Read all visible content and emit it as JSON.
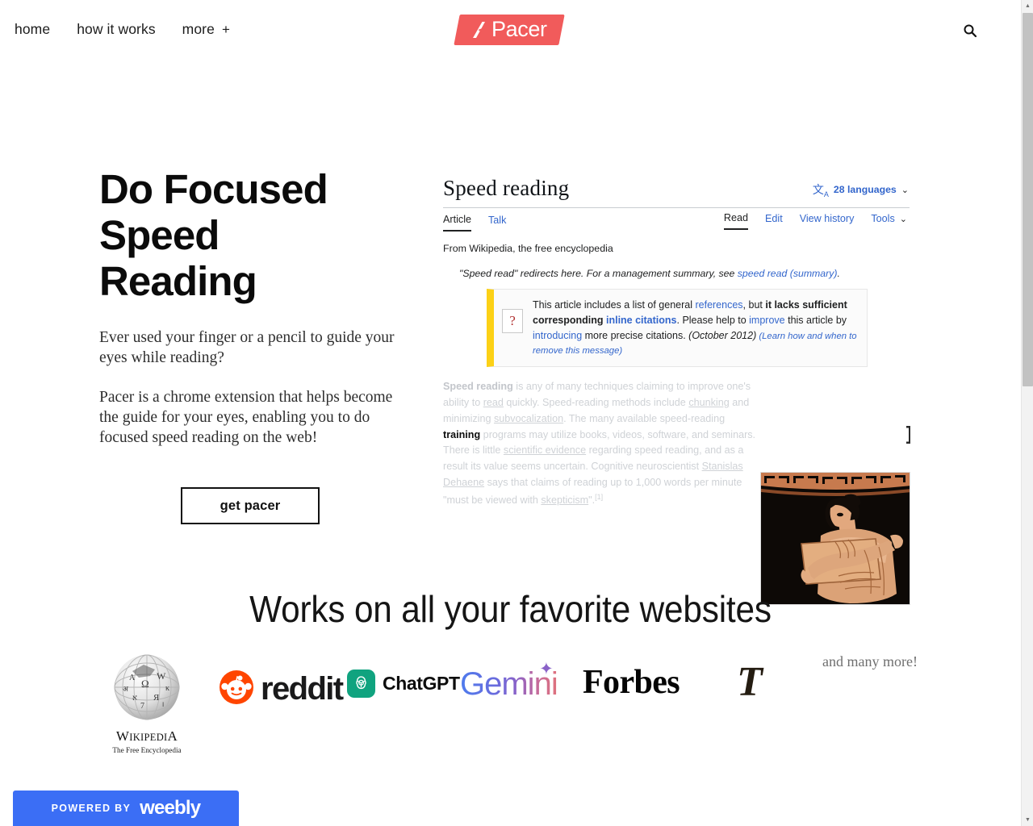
{
  "nav": {
    "links": [
      {
        "label": "home"
      },
      {
        "label": "how it works"
      },
      {
        "label": "more",
        "plus": "+"
      }
    ],
    "logo": {
      "word": "Pacer",
      "mark": "pacer-a-mark",
      "bg_color": "#f15b5b"
    },
    "search_icon": "search-icon"
  },
  "hero": {
    "title": "Do Focused\nSpeed\nReading",
    "paragraphs": [
      "Ever used your finger or a pencil to guide your eyes while reading?",
      "Pacer is a chrome extension that helps become the guide for your eyes, enabling you to do focused speed reading on the web!"
    ],
    "cta": "get pacer"
  },
  "wiki": {
    "title": "Speed reading",
    "languages": "28 languages",
    "lang_icon": "translate-icon",
    "chevron": "⌄",
    "tabs_left": [
      {
        "label": "Article",
        "active": true
      },
      {
        "label": "Talk",
        "active": false
      }
    ],
    "tabs_right": [
      {
        "label": "Read",
        "active": true
      },
      {
        "label": "Edit",
        "active": false
      },
      {
        "label": "View history",
        "active": false
      },
      {
        "label": "Tools",
        "active": false
      }
    ],
    "from": "From Wikipedia, the free encyclopedia",
    "hatnote": {
      "pre": "\"Speed read\" redirects here. For a management summary, see ",
      "link": "speed read (summary)",
      "post": "."
    },
    "notice": {
      "icon": "?",
      "segments": [
        {
          "text": "This article includes a list of general ",
          "style": "plain"
        },
        {
          "text": "references",
          "style": "link"
        },
        {
          "text": ", but ",
          "style": "plain"
        },
        {
          "text": "it lacks sufficient corresponding ",
          "style": "bold"
        },
        {
          "text": "inline citations",
          "style": "boldlink"
        },
        {
          "text": ". Please help to ",
          "style": "plain"
        },
        {
          "text": "improve",
          "style": "link"
        },
        {
          "text": " this article by ",
          "style": "plain"
        },
        {
          "text": "introducing",
          "style": "link"
        },
        {
          "text": " more precise citations. ",
          "style": "plain"
        },
        {
          "text": "(October 2012)",
          "style": "italic"
        },
        {
          "text": " (Learn how and when to remove this message)",
          "style": "smallitalic"
        }
      ]
    },
    "body": {
      "segments": [
        {
          "text": "Speed reading",
          "style": "bold"
        },
        {
          "text": " is any of many techniques claiming to improve one's ability to ",
          "style": "plain"
        },
        {
          "text": "read",
          "style": "link"
        },
        {
          "text": " quickly. Speed-reading methods include ",
          "style": "plain"
        },
        {
          "text": "chunking",
          "style": "link"
        },
        {
          "text": " and minimizing ",
          "style": "plain"
        },
        {
          "text": "subvocalization",
          "style": "link"
        },
        {
          "text": ". The many available speed-reading ",
          "style": "plain"
        },
        {
          "text": "training",
          "style": "highlight"
        },
        {
          "text": " programs may utilize books, videos, software, and seminars. There is little ",
          "style": "plain"
        },
        {
          "text": "scientific evidence",
          "style": "link"
        },
        {
          "text": " regarding speed reading, and as a result its value seems uncertain. Cognitive neuroscientist ",
          "style": "plain"
        },
        {
          "text": "Stanislas Dehaene",
          "style": "link"
        },
        {
          "text": " says that claims of reading up to 1,000 words per minute \"must be viewed with ",
          "style": "plain"
        },
        {
          "text": "skepticism",
          "style": "link"
        },
        {
          "text": "\".",
          "style": "plain"
        },
        {
          "text": "[1]",
          "style": "sup"
        }
      ]
    },
    "figure_alt": "greek-vase-woman-reading-scroll",
    "cursor": "text-ibeam-cursor"
  },
  "websites": {
    "title": "Works on all your favorite websites",
    "logos": [
      {
        "name": "wikipedia",
        "word": "W",
        "word_rest": "IKIPEDI",
        "word_end": "A",
        "sub": "The Free Encyclopedia"
      },
      {
        "name": "reddit",
        "word": "reddit",
        "color": "#ff4500"
      },
      {
        "name": "chatgpt",
        "word": "ChatGPT",
        "color": "#10a37f"
      },
      {
        "name": "gemini",
        "word": "Gemini",
        "spark": "✦"
      },
      {
        "name": "forbes",
        "word": "Forbes"
      },
      {
        "name": "nytimes",
        "word": "T"
      },
      {
        "name": "and-many-more",
        "word": "and many more!"
      }
    ]
  },
  "footer": {
    "weebly_pre": "POWERED BY",
    "weebly_brand": "weebly",
    "weebly_color": "#3b6ef5"
  },
  "scrollbar": {
    "up_arrow": "▲",
    "down_arrow": "▼"
  }
}
